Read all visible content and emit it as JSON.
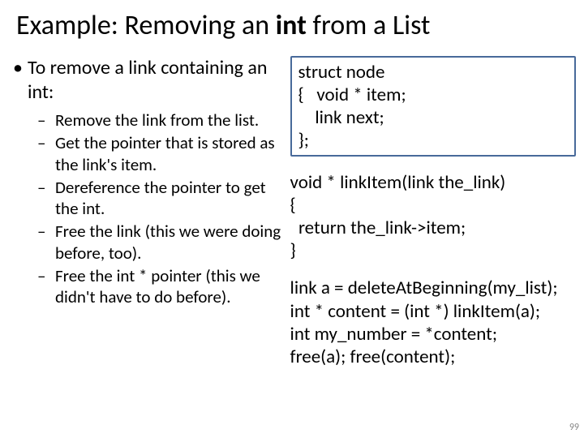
{
  "title": {
    "pre": "Example: Removing an ",
    "bold": "int",
    "post": " from a List"
  },
  "left": {
    "main": "To remove a link containing an int:",
    "subs": [
      "Remove the link from the list.",
      "Get the pointer that is stored as the link's item.",
      "Dereference the pointer to get the int.",
      "Free the link (this we were doing before, too).",
      "Free the int * pointer (this we didn't have to do before)."
    ]
  },
  "right": {
    "struct": "struct node\n{   void * item;\n    link next;\n};",
    "func": "void * linkItem(link the_link)\n{\n  return the_link->item;\n}",
    "usage": "link a = deleteAtBeginning(my_list);\nint * content = (int *) linkItem(a);\nint my_number = *content;\nfree(a); free(content);"
  },
  "pagenum": "99"
}
